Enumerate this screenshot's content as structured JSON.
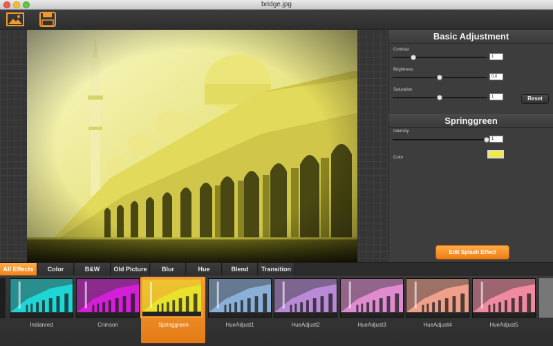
{
  "window": {
    "title": "bridge.jpg"
  },
  "toolbar": {
    "open_icon": "image-icon",
    "save_icon": "floppy-disk-icon"
  },
  "panel": {
    "basic_title": "Basic Adjustment",
    "contrast": {
      "label": "Contrast",
      "value": "1",
      "level": 0.22
    },
    "brightness": {
      "label": "Brightness",
      "value": "0.0",
      "level": 0.5
    },
    "saturation": {
      "label": "Saturation",
      "value": "1",
      "level": 0.5
    },
    "reset_label": "Reset",
    "effect_title": "Springgreen",
    "intensity": {
      "label": "Intensity",
      "value": "1",
      "level": 1.0
    },
    "color_label": "Color",
    "color_value": "#f5ee2b",
    "splash_label": "Edit Splash Effect"
  },
  "tabs": [
    {
      "label": "All Effects",
      "active": true
    },
    {
      "label": "Color",
      "active": false
    },
    {
      "label": "B&W",
      "active": false
    },
    {
      "label": "Old Picture",
      "active": false
    },
    {
      "label": "Blur",
      "active": false
    },
    {
      "label": "Hue",
      "active": false
    },
    {
      "label": "Blend",
      "active": false
    },
    {
      "label": "Transition",
      "active": false
    }
  ],
  "effects": [
    {
      "label": "Indianred",
      "tint": "#1fd6d6",
      "selected": false
    },
    {
      "label": "Crimson",
      "tint": "#d31fd6",
      "selected": false
    },
    {
      "label": "Springgreen",
      "tint": "#e8e22a",
      "selected": true
    },
    {
      "label": "HueAdjust1",
      "tint": "#8ab0d8",
      "selected": false
    },
    {
      "label": "HueAdjust2",
      "tint": "#b88ad8",
      "selected": false
    },
    {
      "label": "HueAdjust3",
      "tint": "#e08ad0",
      "selected": false
    },
    {
      "label": "HueAdjust4",
      "tint": "#f0a08a",
      "selected": false
    },
    {
      "label": "HueAdjust5",
      "tint": "#f08aa0",
      "selected": false
    }
  ],
  "colors": {
    "accent": "#f29a2e",
    "photo_tint": "#e8e22a"
  }
}
